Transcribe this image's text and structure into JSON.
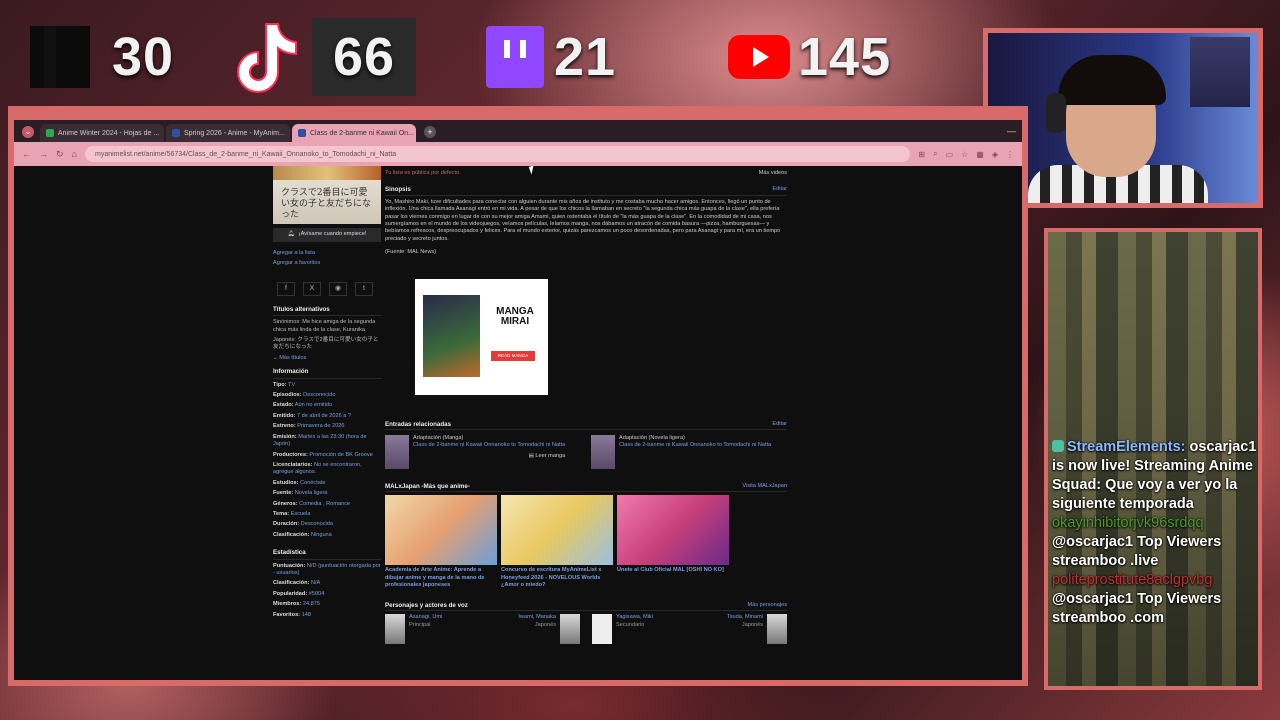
{
  "overlay_stats": {
    "kick": {
      "icon": "kick-icon",
      "count": "30"
    },
    "tiktok": {
      "icon": "tiktok-icon",
      "count": "66"
    },
    "twitch": {
      "icon": "twitch-icon",
      "count": "21"
    },
    "youtube": {
      "icon": "youtube-icon",
      "count": "145"
    }
  },
  "chat": {
    "messages": [
      {
        "user": "StreamElements:",
        "text": "oscarjac1 is now live! Streaming Anime Squad: Que voy a ver yo la siguiente temporada"
      },
      {
        "spam": "okayinhibitorjvk96srdqq"
      },
      {
        "text": "@oscarjac1 Top Viewers streamboo .live"
      },
      {
        "spam2": "politeprostitute8aclgpvbg"
      },
      {
        "text": "@oscarjac1 Top Viewers streamboo .com"
      }
    ]
  },
  "browser": {
    "tabs": [
      {
        "label": "Anime Winter 2024 - Hojas de ...",
        "color": "#2fa84f"
      },
      {
        "label": "Spring 2026 - Anime - MyAnim...",
        "color": "#2e51a2"
      },
      {
        "label": "Class de 2-banme ni Kawaii On...",
        "color": "#2e51a2"
      }
    ],
    "url": "myanimelist.net/anime/56734/Class_de_2-banme_ni_Kawaii_Onnanoko_to_Tomodachi_ni_Natta"
  },
  "mal": {
    "cover_title": "クラスで2番目に可愛い女の子と友だちになった",
    "notify_label": "¡Avísame cuando empiece!",
    "add_list": "Agregar a la lista",
    "add_fav": "Agregar a favoritos",
    "alt_titles_header": "Títulos alternativos",
    "synonyms": "Sinónimos: Me hice amiga de la segunda chica más linda de la clase, Kuranika",
    "japanese": "Japonés: クラスで2番目に可愛い女の子と友だちになった",
    "more_titles": "Más títulos",
    "info_header": "Información",
    "info": [
      {
        "k": "Tipo:",
        "v": "TV"
      },
      {
        "k": "Episodios:",
        "v": "Desconocido"
      },
      {
        "k": "Estado:",
        "v": "Aún no emitido"
      },
      {
        "k": "Emitido:",
        "v": "7 de abril de 2026 a ?"
      },
      {
        "k": "Estreno:",
        "v": "Primavera de 2026"
      },
      {
        "k": "Emisión:",
        "v": "Martes a las 23:30 (hora de Japón)"
      },
      {
        "k": "Productores:",
        "v": "Promoción de BK Groove"
      },
      {
        "k": "Licenciatarios:",
        "v": "No se encontraron, agregue algunos."
      },
      {
        "k": "Estudios:",
        "v": "Conéctate"
      },
      {
        "k": "Fuente:",
        "v": "Novela ligera"
      },
      {
        "k": "Géneros:",
        "v": "Comedia , Romance"
      },
      {
        "k": "Tema:",
        "v": "Escuela"
      },
      {
        "k": "Duración:",
        "v": "Desconocida"
      },
      {
        "k": "Clasificación:",
        "v": "Ninguna"
      }
    ],
    "stats_header": "Estadística",
    "stats": [
      {
        "k": "Puntuación:",
        "v": "N/D (puntuación otorgada por - usuarios)"
      },
      {
        "k": "Clasificación:",
        "v": "N/A"
      },
      {
        "k": "Popularidad:",
        "v": "#5004"
      },
      {
        "k": "Miembros:",
        "v": "24.875"
      },
      {
        "k": "Favoritos:",
        "v": "148"
      }
    ],
    "public_note": "Tu lista es pública por defecto.",
    "more_videos": "Más videos",
    "synopsis_header": "Sinopsis",
    "edit": "Editar",
    "synopsis": "Yo, Mashiro Maki, tuve dificultades para conectar con alguien durante mis años de instituto y me costaba mucho hacer amigos. Entonces, llegó un punto de inflexión. Una chica llamada Asanagi entró en mi vida. A pesar de que los chicos la llamaban en secreto \"la segunda chica más guapa de la clase\", ella prefería pasar los viernes conmigo en lugar de con su mejor amiga Amami, quien ostentaba el título de \"la más guapa de la clase\". En la comodidad de mi casa, nos sumergíamos en el mundo de los videojuegos, veíamos películas, leíamos manga, nos dábamos un atracón de comida basura —pizza, hamburguesas— y bebíamos refrescos, despreocupados y felices. Para el mundo exterior, quizás parezcamos un poco desordenadas, pero para Asanagi y para mí, era un tiempo preciado y secreto juntos.",
    "source": "(Fuente: MAL News)",
    "ad_brand": "MANGA MIRAI",
    "ad_button": "READ MANGA",
    "related_header": "Entradas relacionadas",
    "related": [
      {
        "kind": "Adaptación (Manga)",
        "title": "Class de 2-banme ni Kawaii Onnanoko to Tomodachi ni Natta"
      },
      {
        "kind": "Adaptación (Novela ligera)",
        "title": "Class de 2-banme ni Kawaii Onnanoko to Tomodachi ni Natta"
      }
    ],
    "read_manga": "Leer manga",
    "japan_header": "MALxJapan -Más que anime-",
    "japan_visit": "Visita MALxJapan",
    "cards": [
      {
        "caption": "Academia de Arte Anime: Aprende a dibujar anime y manga de la mano de profesionales japoneses"
      },
      {
        "caption": "Concurso de escritura MyAnimeList x Honeyfeed 2026 - NOVELOUS Worlds ¿Amor o miedo?"
      },
      {
        "caption": "Únete al Club Oficial MAL [OSHI NO KO]"
      }
    ],
    "chars_header": "Personajes y actores de voz",
    "chars_more": "Más personajes",
    "chars": [
      {
        "name": "Asanagi, Umi",
        "role": "Principal",
        "va": "Iwami, Manaka",
        "lang": "Japonés"
      },
      {
        "name": "Yagisawa, Miki",
        "role": "Secundario",
        "va": "Tsuda, Minami",
        "lang": "Japonés"
      }
    ]
  }
}
